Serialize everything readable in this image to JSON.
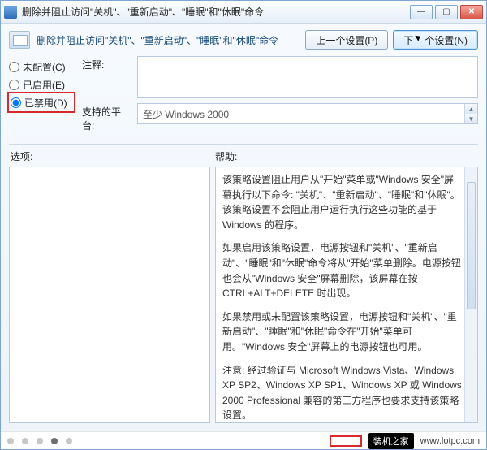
{
  "title": "删除并阻止访问\"关机\"、\"重新启动\"、\"睡眠\"和\"休眠\"命令",
  "desc": "删除并阻止访问\"关机\"、\"重新启动\"、\"睡眠\"和\"休眠\"命令",
  "nav": {
    "prev": "上一个设置(P)",
    "next_a": "下",
    "next_b": "个设置(N)"
  },
  "radios": {
    "unconfigured": "未配置(C)",
    "enabled": "已启用(E)",
    "disabled": "已禁用(D)"
  },
  "labels": {
    "comment": "注释:",
    "platform": "支持的平台:",
    "options": "选项:",
    "help": "帮助:"
  },
  "platform": "至少 Windows 2000",
  "help": {
    "p1": "该策略设置阻止用户从\"开始\"菜单或\"Windows 安全\"屏幕执行以下命令: \"关机\"、\"重新启动\"、\"睡眠\"和\"休眠\"。该策略设置不会阻止用户运行执行这些功能的基于 Windows 的程序。",
    "p2": "如果启用该策略设置，电源按钮和\"关机\"、\"重新启动\"、\"睡眠\"和\"休眠\"命令将从\"开始\"菜单删除。电源按钮也会从\"Windows 安全\"屏幕删除，该屏幕在按 CTRL+ALT+DELETE 时出现。",
    "p3": "如果禁用或未配置该策略设置，电源按钮和\"关机\"、\"重新启动\"、\"睡眠\"和\"休眠\"命令在\"开始\"菜单可用。\"Windows 安全\"屏幕上的电源按钮也可用。",
    "p4": "注意: 经过验证与 Microsoft Windows Vista、Windows XP SP2、Windows XP SP1、Windows XP 或 Windows 2000 Professional 兼容的第三方程序也要求支持该策略设置。"
  },
  "brand": {
    "name": "装机之家",
    "url": "www.lotpc.com"
  }
}
